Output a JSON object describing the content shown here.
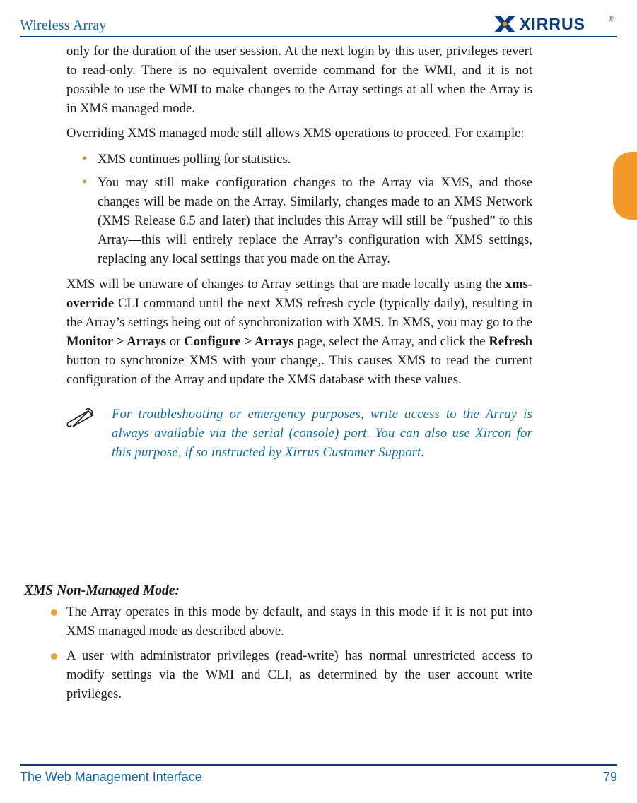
{
  "header": {
    "title": "Wireless Array",
    "brand": "XIRRUS"
  },
  "body": {
    "p1": "only for the duration of the user session. At the next login by this user, privileges revert to read-only. There is no equivalent override command for the WMI, and it is not possible to use the WMI to make changes to the Array settings at all when the Array is in XMS managed mode.",
    "p2": "Overriding XMS managed mode still allows XMS operations to proceed. For example:",
    "inner_bullets": [
      "XMS continues polling for statistics.",
      "You may still make configuration changes to the Array via XMS, and those changes will be made on the Array. Similarly, changes made to an XMS Network (XMS Release 6.5 and later) that includes this Array will still be “pushed” to this Array—this will entirely replace the Array’s configuration with XMS settings, replacing any local settings that you made on the Array."
    ],
    "p3_a": "XMS will be unaware of changes to Array settings that are made locally using the ",
    "p3_b_bold": "xms-override",
    "p3_c": " CLI command until the next XMS refresh cycle (typically daily), resulting in the Array’s settings being out of synchronization with XMS. In XMS, you may go to the ",
    "p3_d_bold": "Monitor > Arrays",
    "p3_e": " or ",
    "p3_f_bold": "Configure > Arrays",
    "p3_g": " page, select the Array, and click the ",
    "p3_h_bold": "Refresh",
    "p3_i": " button to synchronize XMS with your change,. This causes XMS to read the current configuration of the Array and update the XMS database with these values.",
    "note": "For troubleshooting or emergency purposes, write access to the Array is always available via the serial (console) port. You can also use Xircon for this purpose, if so instructed by Xirrus Customer Support."
  },
  "sub": {
    "heading": "XMS Non-Managed Mode:",
    "bullets": [
      "The Array operates in this mode by default, and stays in this mode if it is not put into XMS managed mode as described above.",
      "A user with administrator privileges (read-write) has normal unrestricted access to modify settings via the WMI and CLI, as determined by the user account write privileges."
    ]
  },
  "footer": {
    "left": "The Web Management Interface",
    "right": "79"
  }
}
